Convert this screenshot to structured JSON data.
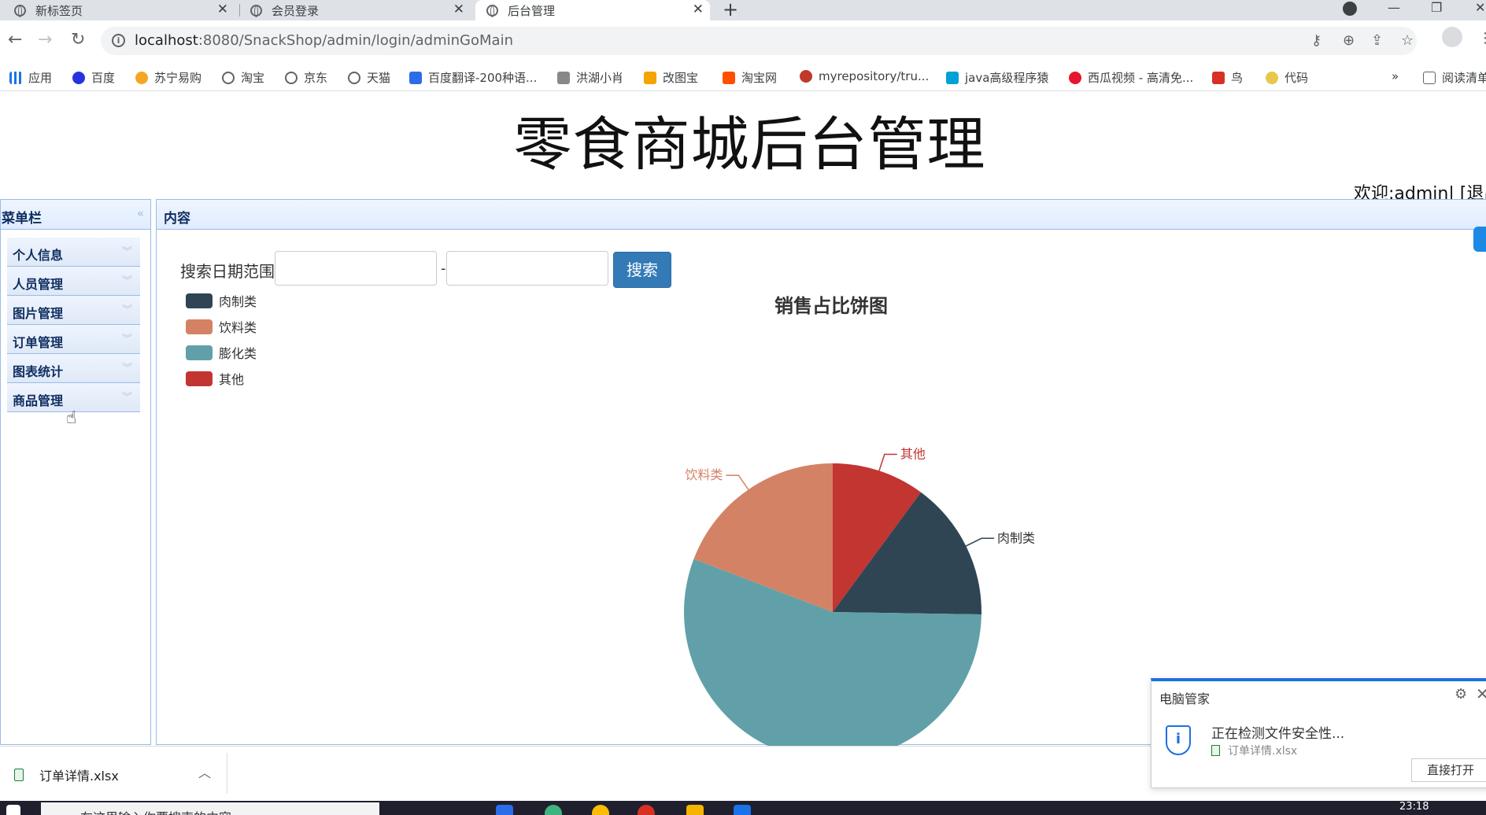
{
  "browser": {
    "tabs": [
      {
        "title": "新标签页"
      },
      {
        "title": "会员登录"
      },
      {
        "title": "后台管理"
      }
    ],
    "url_host": "localhost",
    "url_path": ":8080/SnackShop/admin/login/adminGoMain",
    "bookmarks": [
      {
        "label": "应用",
        "color": "#1a73e8"
      },
      {
        "label": "百度",
        "color": "#2932e1"
      },
      {
        "label": "苏宁易购",
        "color": "#f5a623"
      },
      {
        "label": "淘宝",
        "color": "#5f6368"
      },
      {
        "label": "京东",
        "color": "#5f6368"
      },
      {
        "label": "天猫",
        "color": "#5f6368"
      },
      {
        "label": "百度翻译-200种语...",
        "color": "#2b6de8"
      },
      {
        "label": "洪湖小肖",
        "color": "#888888"
      },
      {
        "label": "改图宝",
        "color": "#f4a300"
      },
      {
        "label": "淘宝网",
        "color": "#ff5000"
      },
      {
        "label": "myrepository/tru...",
        "color": "#c0392b"
      },
      {
        "label": "java高级程序猿",
        "color": "#00a1d6"
      },
      {
        "label": "西瓜视频 - 高清免...",
        "color": "#e6162d"
      },
      {
        "label": "鸟",
        "color": "#d93025"
      },
      {
        "label": "代码",
        "color": "#e8c74a"
      }
    ],
    "overflow": "»",
    "reading_list": "阅读清单"
  },
  "page": {
    "title": "零食商城后台管理",
    "welcome": "欢迎:admin| [退出]"
  },
  "menu": {
    "header": "菜单栏",
    "items": [
      {
        "label": "个人信息"
      },
      {
        "label": "人员管理"
      },
      {
        "label": "图片管理"
      },
      {
        "label": "订单管理"
      },
      {
        "label": "图表统计"
      },
      {
        "label": "商品管理"
      }
    ]
  },
  "content": {
    "header": "内容",
    "search_label": "搜索日期范围:",
    "start_date": "",
    "end_date": "",
    "dash": "-",
    "search_button": "搜索"
  },
  "chart_data": {
    "type": "pie",
    "title": "销售占比饼图",
    "legend_position": "top-left",
    "series": [
      {
        "name": "肉制类",
        "value": 15,
        "color": "#2f4554"
      },
      {
        "name": "饮料类",
        "value": 19,
        "color": "#d48265"
      },
      {
        "name": "膨化类",
        "value": 55,
        "color": "#61a0a8"
      },
      {
        "name": "其他",
        "value": 10,
        "color": "#c23531"
      }
    ]
  },
  "downloads": {
    "file": "订单详情.xlsx"
  },
  "popup": {
    "title": "电脑管家",
    "message": "正在检测文件安全性...",
    "file": "订单详情.xlsx",
    "open_button": "直接打开"
  },
  "taskbar": {
    "search_placeholder": "在这里输入你要搜索的内容",
    "time": "23:18"
  }
}
